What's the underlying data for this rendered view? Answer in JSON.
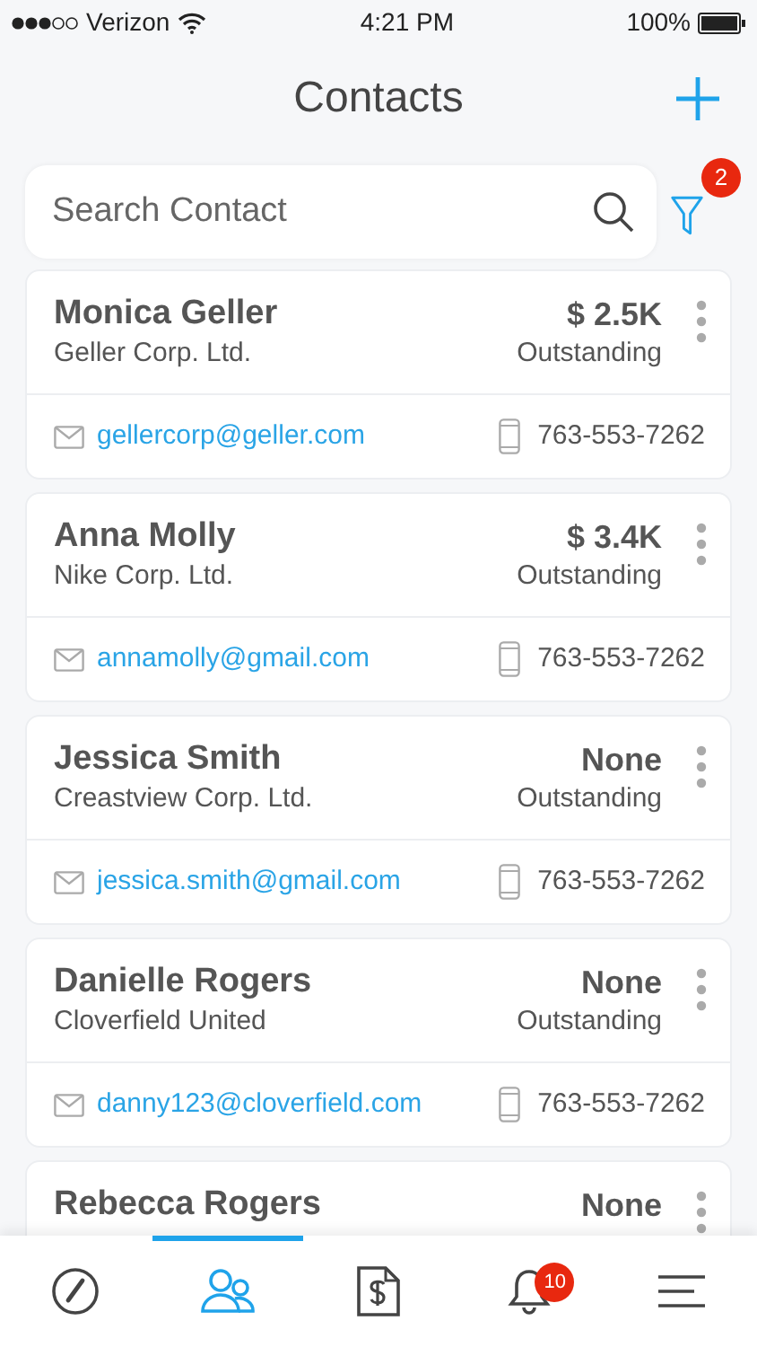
{
  "status_bar": {
    "carrier": "Verizon",
    "time": "4:21 PM",
    "battery": "100%"
  },
  "header": {
    "title": "Contacts"
  },
  "search": {
    "placeholder": "Search Contact"
  },
  "filter": {
    "badge": "2"
  },
  "contacts": [
    {
      "name": "Monica Geller",
      "company": "Geller Corp. Ltd.",
      "amount": "$ 2.5K",
      "status": "Outstanding",
      "email": "gellercorp@geller.com",
      "phone": "763-553-7262"
    },
    {
      "name": "Anna Molly",
      "company": "Nike Corp. Ltd.",
      "amount": "$ 3.4K",
      "status": "Outstanding",
      "email": "annamolly@gmail.com",
      "phone": "763-553-7262"
    },
    {
      "name": "Jessica Smith",
      "company": "Creastview Corp. Ltd.",
      "amount": "None",
      "status": "Outstanding",
      "email": "jessica.smith@gmail.com",
      "phone": "763-553-7262"
    },
    {
      "name": "Danielle Rogers",
      "company": "Cloverfield United",
      "amount": "None",
      "status": "Outstanding",
      "email": "danny123@cloverfield.com",
      "phone": "763-553-7262"
    },
    {
      "name": "Rebecca Rogers",
      "amount": "None"
    }
  ],
  "tab_bar": [
    {
      "kind": "dashboard",
      "selected": false
    },
    {
      "kind": "contacts",
      "selected": true
    },
    {
      "kind": "invoices",
      "selected": false
    },
    {
      "kind": "notifications",
      "selected": false,
      "badge": "10"
    },
    {
      "kind": "menu",
      "selected": false
    }
  ]
}
